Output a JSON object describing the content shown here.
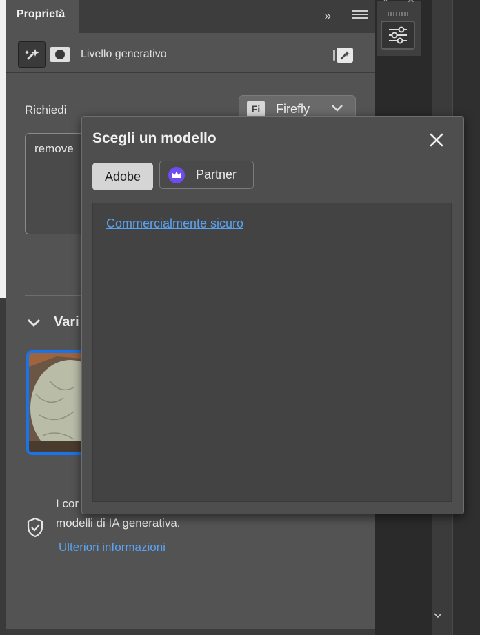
{
  "panel": {
    "tab_title": "Proprietà",
    "collapse_glyph": "»",
    "layer_name": "Livello generativo"
  },
  "prompt": {
    "label": "Richiedi",
    "model_badge": "Fi",
    "model_name": "Firefly",
    "text": "remove"
  },
  "variations": {
    "title": "Vari"
  },
  "info": {
    "text_line1": "I cor",
    "text_line2": "modelli di IA generativa.",
    "link": "Ulteriori informazioni"
  },
  "popover": {
    "title": "Scegli un modello",
    "tabs": [
      {
        "label": "Adobe",
        "selected": true
      },
      {
        "label": "Partner",
        "selected": false
      }
    ],
    "commercial_link": "Commercialmente sicuro"
  },
  "colors": {
    "panel_bg": "#535353",
    "link_blue": "#5aa3f0",
    "selection_blue": "#1a73e8",
    "partner_purple": "#6e4df0"
  },
  "icons": [
    "generative-fill-icon",
    "mask-icon",
    "generate-action-icon",
    "firefly-icon",
    "chevron-down-icon",
    "shield-icon",
    "close-icon",
    "crown-icon",
    "adjustments-icon",
    "hamburger-menu-icon"
  ]
}
